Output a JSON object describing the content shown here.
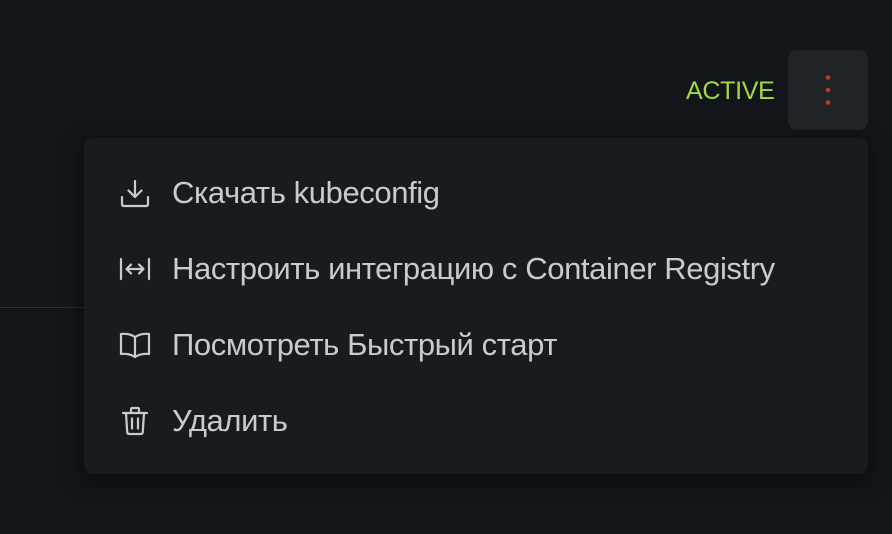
{
  "status": {
    "text": "ACTIVE",
    "color": "#a2db3f"
  },
  "actions_button": {
    "icon": "more-vertical-icon",
    "icon_color": "#c0392b"
  },
  "menu": {
    "items": [
      {
        "label": "Скачать kubeconfig",
        "icon": "download-icon"
      },
      {
        "label": "Настроить интеграцию с Container Registry",
        "icon": "arrows-horizontal-icon"
      },
      {
        "label": "Посмотреть Быстрый старт",
        "icon": "book-icon"
      },
      {
        "label": "Удалить",
        "icon": "trash-icon"
      }
    ]
  }
}
